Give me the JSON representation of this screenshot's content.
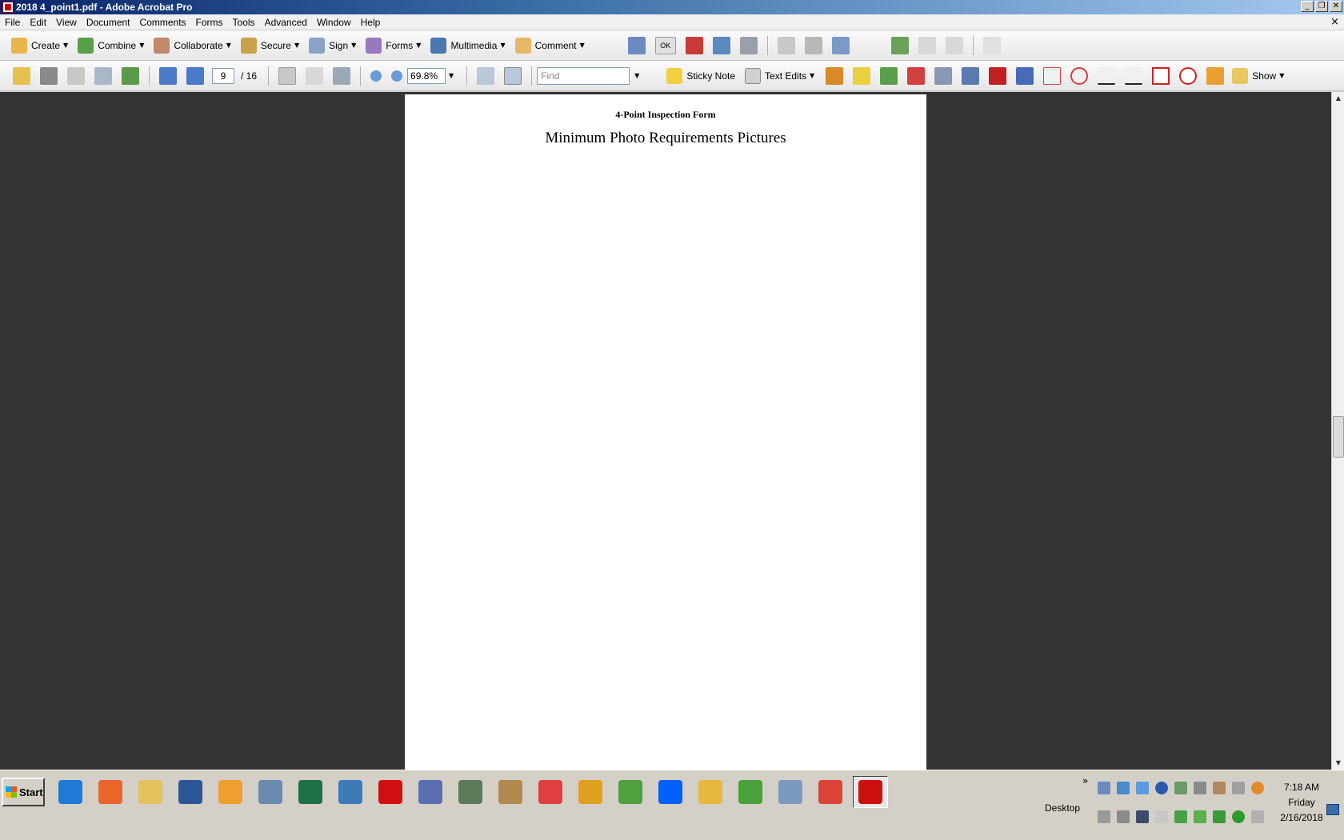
{
  "window": {
    "title": "2018 4_point1.pdf - Adobe Acrobat Pro",
    "min_glyph": "_",
    "restore_glyph": "❐",
    "close_glyph": "✕",
    "doc_close_glyph": "×"
  },
  "menu": [
    "File",
    "Edit",
    "View",
    "Document",
    "Comments",
    "Forms",
    "Tools",
    "Advanced",
    "Window",
    "Help"
  ],
  "toolbar1": {
    "create": "Create",
    "combine": "Combine",
    "collaborate": "Collaborate",
    "secure": "Secure",
    "sign": "Sign",
    "forms": "Forms",
    "multimedia": "Multimedia",
    "comment": "Comment",
    "ok_label": "OK"
  },
  "toolbar2": {
    "page_current": "9",
    "page_total": "/ 16",
    "zoom": "69.8%",
    "find_placeholder": "Find",
    "sticky_note": "Sticky Note",
    "text_edits": "Text Edits",
    "show": "Show"
  },
  "document": {
    "heading": "4-Point Inspection Form",
    "title": "Minimum Photo Requirements Pictures"
  },
  "taskbar": {
    "start": "Start",
    "apps": [
      {
        "name": "internet-explorer-icon",
        "color": "#1f7ad6"
      },
      {
        "name": "firefox-icon",
        "color": "#e8662b"
      },
      {
        "name": "file-explorer-icon",
        "color": "#e6c25a"
      },
      {
        "name": "word-icon",
        "color": "#2b5797"
      },
      {
        "name": "media-player-icon",
        "color": "#f0a030"
      },
      {
        "name": "reader-icon",
        "color": "#6a8ab0"
      },
      {
        "name": "excel-icon",
        "color": "#1e7145"
      },
      {
        "name": "publisher-icon",
        "color": "#3d7ab8"
      },
      {
        "name": "paint-splat-icon",
        "color": "#d01010"
      },
      {
        "name": "tool-app-icon",
        "color": "#5b6fb0"
      },
      {
        "name": "monitor-app-icon",
        "color": "#5a7a5a"
      },
      {
        "name": "photos-icon",
        "color": "#b08850"
      },
      {
        "name": "apps-grid-icon",
        "color": "#e04040"
      },
      {
        "name": "winamp-icon",
        "color": "#e0a020"
      },
      {
        "name": "dvd-app-icon",
        "color": "#50a040"
      },
      {
        "name": "dropbox-icon",
        "color": "#0061fe"
      },
      {
        "name": "outlook-icon",
        "color": "#e8b840"
      },
      {
        "name": "windows-ball-icon",
        "color": "#4aa03a"
      },
      {
        "name": "calculator-icon",
        "color": "#7a9ac0"
      },
      {
        "name": "chrome-icon",
        "color": "#db4437"
      },
      {
        "name": "acrobat-icon",
        "color": "#cc1010"
      }
    ],
    "tray_toggle": "»",
    "desktop": "Desktop",
    "time": "7:18 AM",
    "day": "Friday",
    "date": "2/16/2018"
  }
}
